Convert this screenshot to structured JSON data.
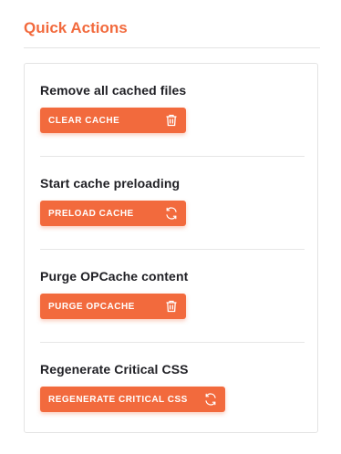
{
  "header": {
    "title": "Quick Actions"
  },
  "actions": [
    {
      "label": "Remove all cached files",
      "button": "CLEAR CACHE",
      "icon": "trash-icon"
    },
    {
      "label": "Start cache preloading",
      "button": "PRELOAD CACHE",
      "icon": "refresh-icon"
    },
    {
      "label": "Purge OPCache content",
      "button": "PURGE OPCACHE",
      "icon": "trash-icon"
    },
    {
      "label": "Regenerate Critical CSS",
      "button": "REGENERATE CRITICAL CSS",
      "icon": "refresh-icon"
    }
  ],
  "colors": {
    "accent": "#f26a3d",
    "text": "#1f1f24",
    "border": "#e4e4e4"
  }
}
